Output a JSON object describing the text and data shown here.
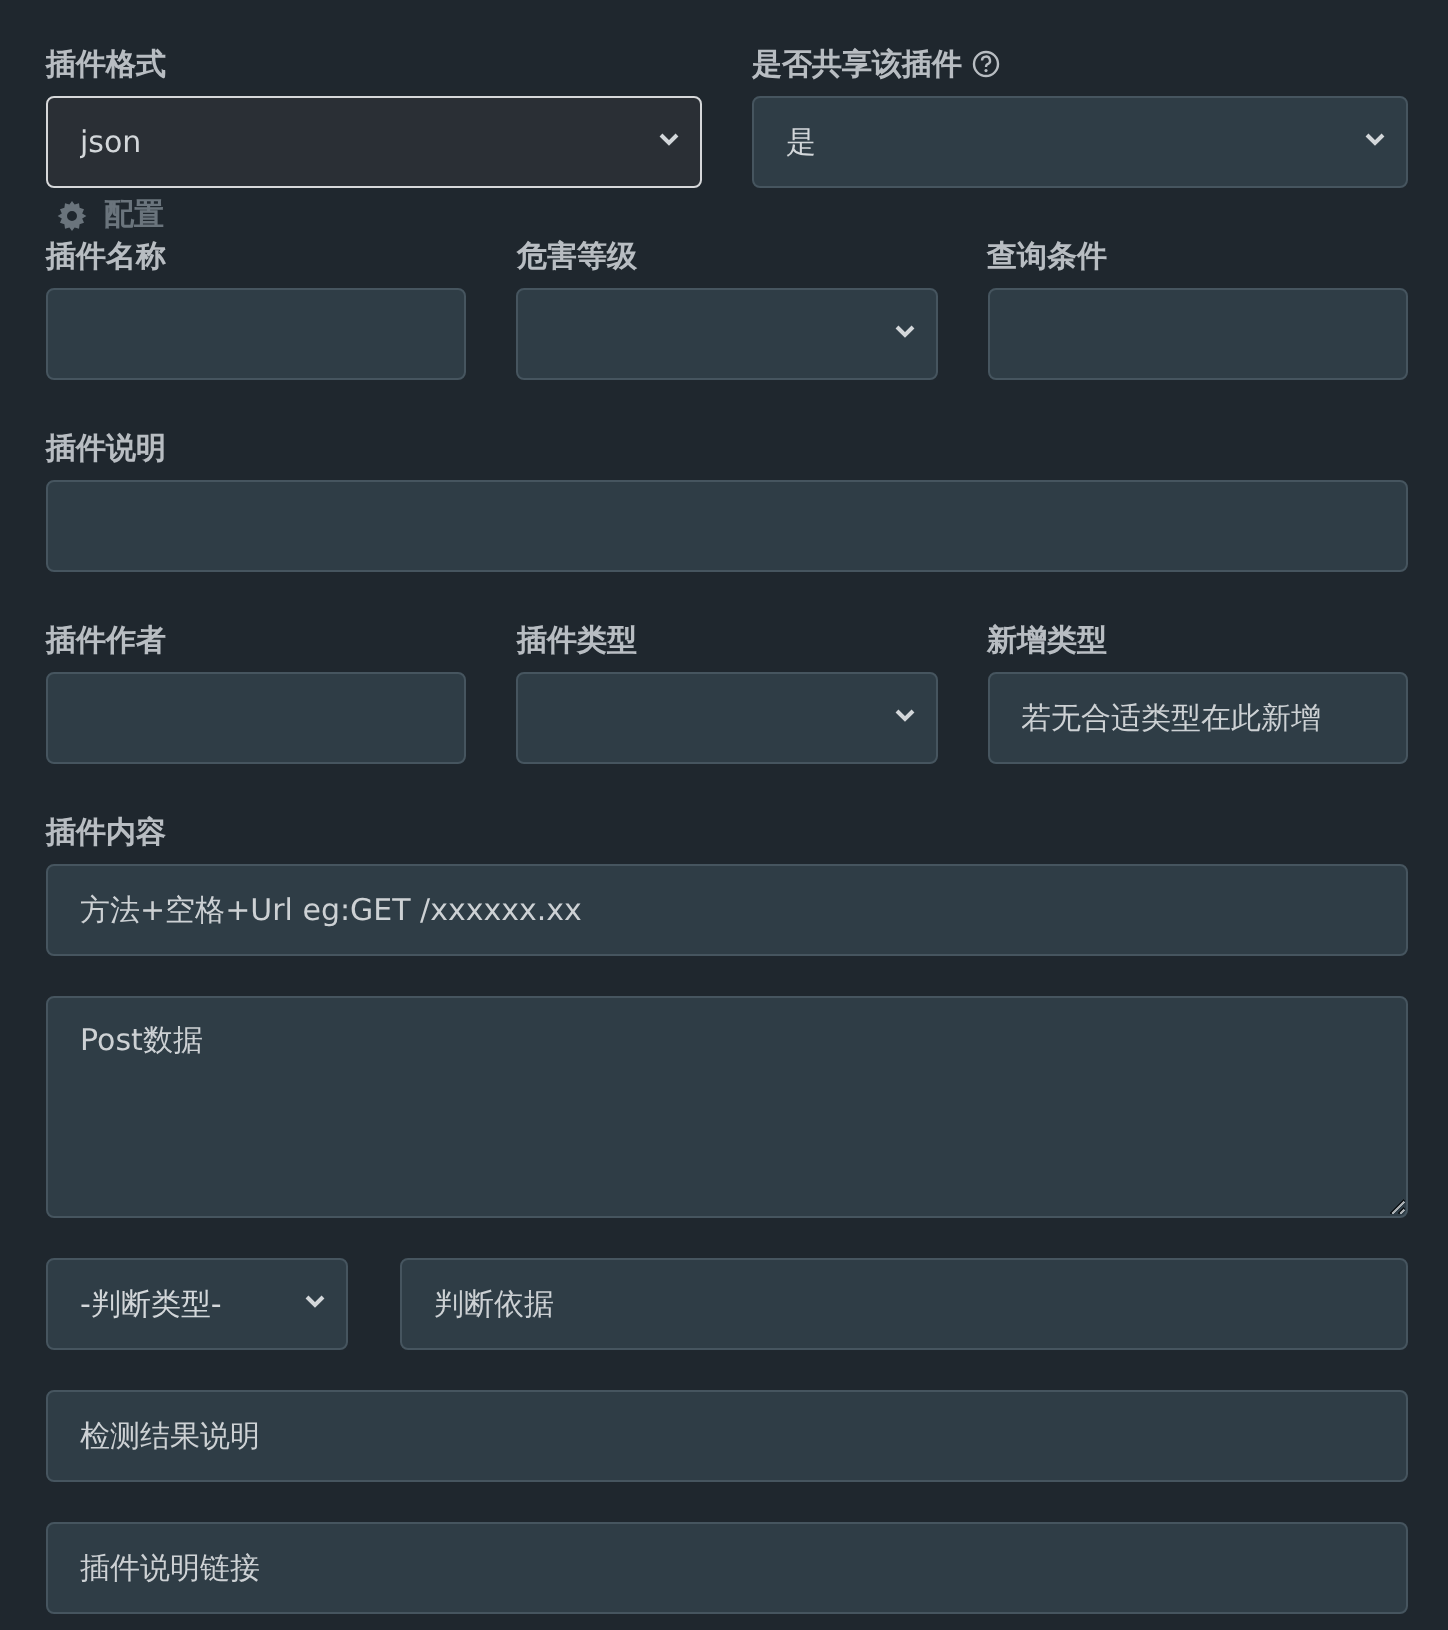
{
  "background": {
    "config_label": "配置"
  },
  "rows": [
    {
      "fields": [
        {
          "label": "插件格式",
          "kind": "select",
          "value": "json",
          "focused": true
        },
        {
          "label": "是否共享该插件",
          "help": true,
          "kind": "select",
          "value": "是",
          "focused": false
        }
      ]
    },
    {
      "fields": [
        {
          "label": "插件名称",
          "kind": "input",
          "focused": false
        },
        {
          "label": "危害等级",
          "kind": "select",
          "focused": false
        },
        {
          "label": "查询条件",
          "kind": "input",
          "focused": false
        }
      ]
    },
    {
      "fields": [
        {
          "label": "插件说明",
          "kind": "input",
          "focused": false
        }
      ]
    },
    {
      "fields": [
        {
          "label": "插件作者",
          "kind": "input",
          "focused": false
        },
        {
          "label": "插件类型",
          "kind": "select",
          "focused": false
        },
        {
          "label": "新增类型",
          "kind": "input",
          "placeholder": "若无合适类型在此新增",
          "focused": false
        }
      ]
    },
    {
      "fields": [
        {
          "label": "插件内容",
          "kind": "input",
          "placeholder": "方法+空格+Url eg:GET /xxxxxx.xx",
          "focused": false
        }
      ]
    },
    {
      "fields": [
        {
          "kind": "textarea",
          "placeholder": "Post数据",
          "focused": false
        }
      ]
    },
    {
      "fields": [
        {
          "kind": "select",
          "value": "-判断类型-",
          "focused": false
        },
        {
          "kind": "input",
          "placeholder": "判断依据",
          "focused": false
        }
      ]
    },
    {
      "fields": [
        {
          "kind": "input",
          "placeholder": "检测结果说明",
          "focused": false
        }
      ]
    },
    {
      "fields": [
        {
          "kind": "input",
          "placeholder": "插件说明链接",
          "focused": false
        }
      ]
    }
  ]
}
